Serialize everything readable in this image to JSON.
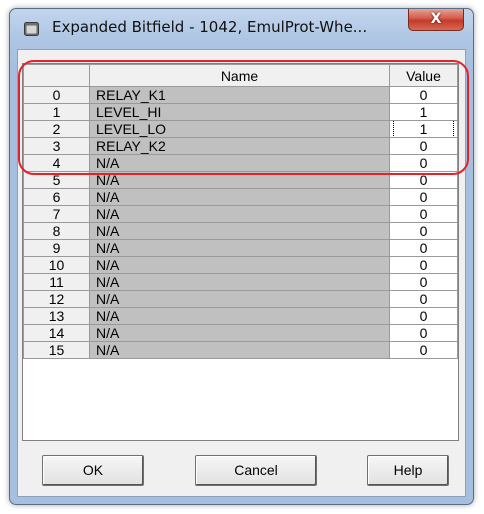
{
  "window": {
    "title": "Expanded Bitfield - 1042, EmulProt-Whe...",
    "close_label": "X",
    "icon": "app-window-icon"
  },
  "grid": {
    "columns": [
      "",
      "Name",
      "Value"
    ],
    "rows": [
      {
        "index": "0",
        "name": "RELAY_K1",
        "value": "0"
      },
      {
        "index": "1",
        "name": "LEVEL_HI",
        "value": "1"
      },
      {
        "index": "2",
        "name": "LEVEL_LO",
        "value": "1"
      },
      {
        "index": "3",
        "name": "RELAY_K2",
        "value": "0"
      },
      {
        "index": "4",
        "name": "N/A",
        "value": "0"
      },
      {
        "index": "5",
        "name": "N/A",
        "value": "0"
      },
      {
        "index": "6",
        "name": "N/A",
        "value": "0"
      },
      {
        "index": "7",
        "name": "N/A",
        "value": "0"
      },
      {
        "index": "8",
        "name": "N/A",
        "value": "0"
      },
      {
        "index": "9",
        "name": "N/A",
        "value": "0"
      },
      {
        "index": "10",
        "name": "N/A",
        "value": "0"
      },
      {
        "index": "11",
        "name": "N/A",
        "value": "0"
      },
      {
        "index": "12",
        "name": "N/A",
        "value": "0"
      },
      {
        "index": "13",
        "name": "N/A",
        "value": "0"
      },
      {
        "index": "14",
        "name": "N/A",
        "value": "0"
      },
      {
        "index": "15",
        "name": "N/A",
        "value": "0"
      }
    ]
  },
  "buttons": {
    "ok": "OK",
    "cancel": "Cancel",
    "help": "Help"
  },
  "colors": {
    "annotation": "#e8202a",
    "name_cell": "#c0c0c0"
  }
}
